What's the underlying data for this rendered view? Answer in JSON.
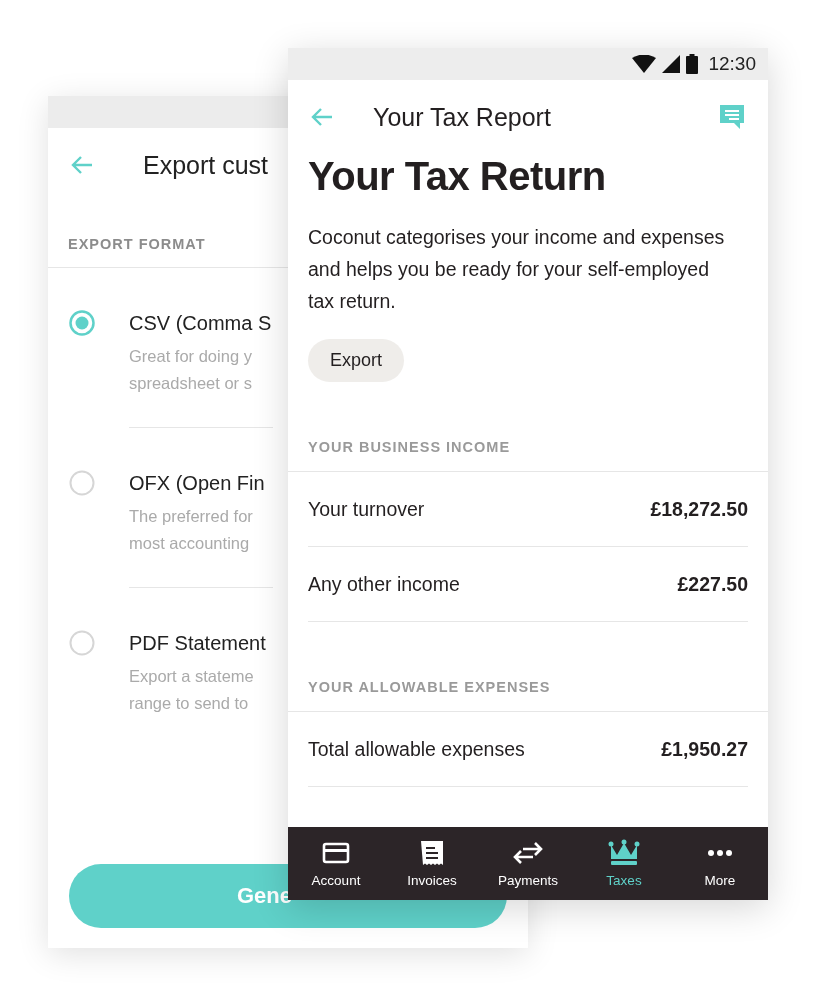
{
  "back_screen": {
    "title": "Export cust",
    "section_label": "EXPORT FORMAT",
    "options": [
      {
        "title": "CSV (Comma S",
        "description_lines": [
          "Great for doing y",
          "spreadsheet or s"
        ],
        "selected": true
      },
      {
        "title": "OFX (Open Fin",
        "description_lines": [
          "The preferred for",
          "most accounting"
        ],
        "selected": false
      },
      {
        "title": "PDF Statement",
        "description_lines": [
          "Export a stateme",
          "range to send to"
        ],
        "selected": false
      }
    ],
    "button": "Gene"
  },
  "front_screen": {
    "status_bar": {
      "time": "12:30"
    },
    "header_title": "Your Tax Report",
    "heading": "Your Tax Return",
    "intro": "Coconut categorises your income and expenses and helps you be ready for your self-employed tax return.",
    "export_button": "Export",
    "sections": [
      {
        "label": "YOUR BUSINESS INCOME",
        "rows": [
          {
            "label": "Your turnover",
            "amount": "£18,272.50"
          },
          {
            "label": "Any other income",
            "amount": "£227.50"
          }
        ]
      },
      {
        "label": "YOUR ALLOWABLE EXPENSES",
        "rows": [
          {
            "label": "Total allowable expenses",
            "amount": "£1,950.27"
          }
        ]
      }
    ],
    "nav": [
      {
        "kind": "card",
        "label": "Account",
        "selected": false
      },
      {
        "kind": "receipt",
        "label": "Invoices",
        "selected": false
      },
      {
        "kind": "arrows",
        "label": "Payments",
        "selected": false
      },
      {
        "kind": "crown",
        "label": "Taxes",
        "selected": true
      },
      {
        "kind": "dots",
        "label": "More",
        "selected": false
      }
    ]
  }
}
